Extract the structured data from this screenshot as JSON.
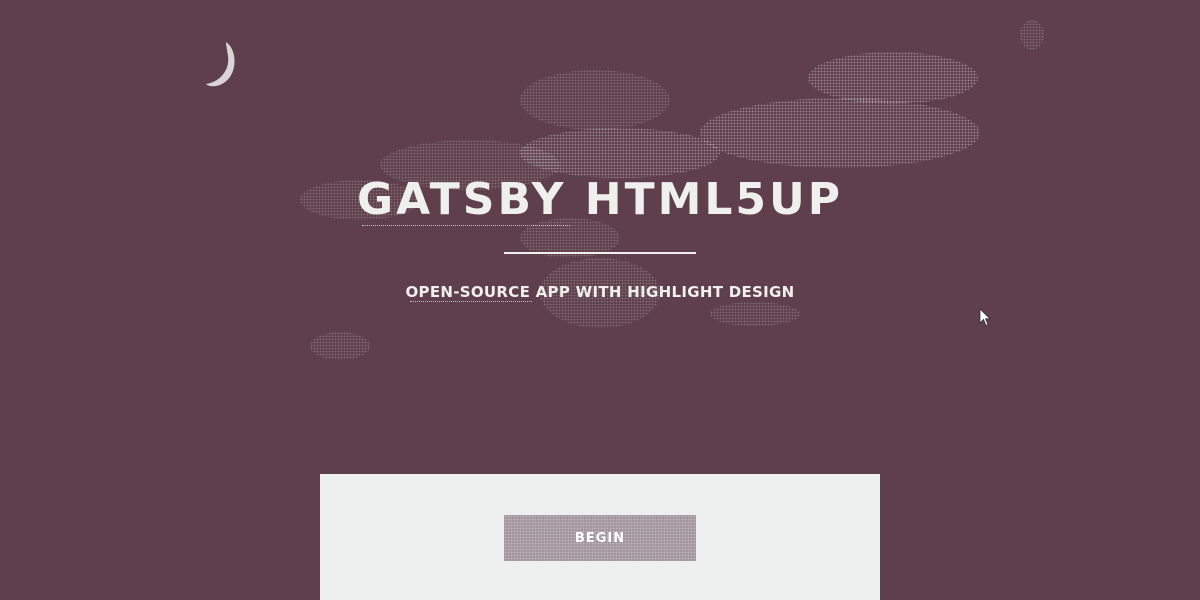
{
  "hero": {
    "title": "GATSBY HTML5UP",
    "subtitle": "OPEN-SOURCE APP WITH HIGHLIGHT DESIGN"
  },
  "actions": {
    "begin_label": "BEGIN"
  },
  "icons": {
    "moon": "moon-icon",
    "cursor": "mouse-pointer-icon"
  },
  "colors": {
    "background": "#5e3f4b",
    "text": "#eef0ee",
    "panel": "#edf0ee",
    "button": "#a3979d"
  }
}
